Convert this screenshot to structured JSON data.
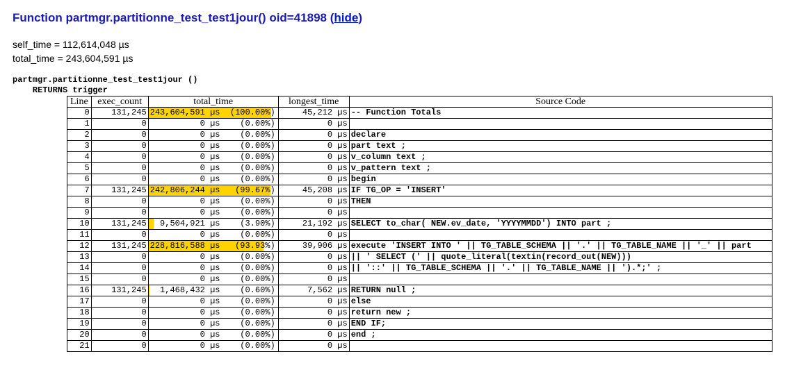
{
  "title_prefix": "Function ",
  "title_func": "partmgr.partitionne_test_test1jour()",
  "title_oid_part": " oid=41898 (",
  "title_hide": "hide",
  "title_suffix": ")",
  "self_time_line": "self_time = 112,614,048 µs",
  "total_time_line": "total_time = 243,604,591 µs",
  "signature": "partmgr.partitionne_test_test1jour ()\n    RETURNS trigger",
  "headers": {
    "line": "Line",
    "exec_count": "exec_count",
    "total_time": "total_time",
    "longest_time": "longest_time",
    "source": "Source Code"
  },
  "rows": [
    {
      "line": "0",
      "exec": "131,245",
      "tt_us": "243,604,591 µs",
      "tt_pct": "(100.00%)",
      "bar": 100.0,
      "lt": "45,212 µs",
      "src": "-- Function Totals"
    },
    {
      "line": "1",
      "exec": "0",
      "tt_us": "0 µs",
      "tt_pct": "(0.00%)",
      "bar": 0,
      "lt": "0 µs",
      "src": ""
    },
    {
      "line": "2",
      "exec": "0",
      "tt_us": "0 µs",
      "tt_pct": "(0.00%)",
      "bar": 0,
      "lt": "0 µs",
      "src": " declare"
    },
    {
      "line": "3",
      "exec": "0",
      "tt_us": "0 µs",
      "tt_pct": "(0.00%)",
      "bar": 0,
      "lt": "0 µs",
      "src": "   part text ;"
    },
    {
      "line": "4",
      "exec": "0",
      "tt_us": "0 µs",
      "tt_pct": "(0.00%)",
      "bar": 0,
      "lt": "0 µs",
      "src": "   v_column text ;"
    },
    {
      "line": "5",
      "exec": "0",
      "tt_us": "0 µs",
      "tt_pct": "(0.00%)",
      "bar": 0,
      "lt": "0 µs",
      "src": "   v_pattern text ;"
    },
    {
      "line": "6",
      "exec": "0",
      "tt_us": "0 µs",
      "tt_pct": "(0.00%)",
      "bar": 0,
      "lt": "0 µs",
      "src": " begin"
    },
    {
      "line": "7",
      "exec": "131,245",
      "tt_us": "242,806,244 µs",
      "tt_pct": "(99.67%)",
      "bar": 99.67,
      "lt": "45,208 µs",
      "src": "   IF TG_OP = 'INSERT'"
    },
    {
      "line": "8",
      "exec": "0",
      "tt_us": "0 µs",
      "tt_pct": "(0.00%)",
      "bar": 0,
      "lt": "0 µs",
      "src": "   THEN"
    },
    {
      "line": "9",
      "exec": "0",
      "tt_us": "0 µs",
      "tt_pct": "(0.00%)",
      "bar": 0,
      "lt": "0 µs",
      "src": ""
    },
    {
      "line": "10",
      "exec": "131,245",
      "tt_us": "9,504,921 µs",
      "tt_pct": "(3.90%)",
      "bar": 3.9,
      "lt": "21,192 µs",
      "src": "     SELECT to_char( NEW.ev_date, 'YYYYMMDD') INTO part ;"
    },
    {
      "line": "11",
      "exec": "0",
      "tt_us": "0 µs",
      "tt_pct": "(0.00%)",
      "bar": 0,
      "lt": "0 µs",
      "src": ""
    },
    {
      "line": "12",
      "exec": "131,245",
      "tt_us": "228,816,588 µs",
      "tt_pct": "(93.93%)",
      "bar": 93.93,
      "lt": "39,906 µs",
      "src": "     execute 'INSERT INTO ' || TG_TABLE_SCHEMA || '.' || TG_TABLE_NAME || '_' || part"
    },
    {
      "line": "13",
      "exec": "0",
      "tt_us": "0 µs",
      "tt_pct": "(0.00%)",
      "bar": 0,
      "lt": "0 µs",
      "src": "          || ' SELECT (' || quote_literal(textin(record_out(NEW)))"
    },
    {
      "line": "14",
      "exec": "0",
      "tt_us": "0 µs",
      "tt_pct": "(0.00%)",
      "bar": 0,
      "lt": "0 µs",
      "src": "          || '::' || TG_TABLE_SCHEMA || '.' || TG_TABLE_NAME || ').*;' ;"
    },
    {
      "line": "15",
      "exec": "0",
      "tt_us": "0 µs",
      "tt_pct": "(0.00%)",
      "bar": 0,
      "lt": "0 µs",
      "src": ""
    },
    {
      "line": "16",
      "exec": "131,245",
      "tt_us": "1,468,432 µs",
      "tt_pct": "(0.60%)",
      "bar": 0.6,
      "lt": "7,562 µs",
      "src": "     RETURN null ;"
    },
    {
      "line": "17",
      "exec": "0",
      "tt_us": "0 µs",
      "tt_pct": "(0.00%)",
      "bar": 0,
      "lt": "0 µs",
      "src": "   else"
    },
    {
      "line": "18",
      "exec": "0",
      "tt_us": "0 µs",
      "tt_pct": "(0.00%)",
      "bar": 0,
      "lt": "0 µs",
      "src": "     return new ;"
    },
    {
      "line": "19",
      "exec": "0",
      "tt_us": "0 µs",
      "tt_pct": "(0.00%)",
      "bar": 0,
      "lt": "0 µs",
      "src": "   END IF;"
    },
    {
      "line": "20",
      "exec": "0",
      "tt_us": "0 µs",
      "tt_pct": "(0.00%)",
      "bar": 0,
      "lt": "0 µs",
      "src": " end ;"
    },
    {
      "line": "21",
      "exec": "0",
      "tt_us": "0 µs",
      "tt_pct": "(0.00%)",
      "bar": 0,
      "lt": "0 µs",
      "src": ""
    }
  ]
}
